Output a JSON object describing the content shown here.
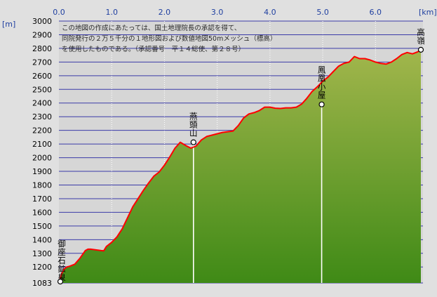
{
  "chart_data": {
    "type": "area",
    "title": "",
    "x_unit": "[km]",
    "y_unit": "[m]",
    "xlim": [
      0,
      6.9
    ],
    "ylim": [
      1083,
      3000
    ],
    "x_ticks": [
      "0.0",
      "1.0",
      "2.0",
      "3.0",
      "4.0",
      "5.0",
      "6.0"
    ],
    "x_tick_values": [
      0,
      1,
      2,
      3,
      4,
      5,
      6
    ],
    "y_ticks": [
      "3000",
      "2900",
      "2800",
      "2700",
      "2600",
      "2500",
      "2400",
      "2300",
      "2200",
      "2100",
      "2000",
      "1900",
      "1800",
      "1700",
      "1600",
      "1500",
      "1400",
      "1300",
      "1200",
      "1083"
    ],
    "y_tick_values": [
      3000,
      2900,
      2800,
      2700,
      2600,
      2500,
      2400,
      2300,
      2200,
      2100,
      2000,
      1900,
      1800,
      1700,
      1600,
      1500,
      1400,
      1300,
      1200,
      1083
    ],
    "grid": true,
    "credit_lines": [
      "この地図の作成にあたっては、国土地理院長の承認を得て、",
      "同院発行の２万５千分の１地形図および数値地図50mメッシュ（標高）",
      "を使用したものである。（承認番号　平１４総使、第２８号）"
    ],
    "series": [
      {
        "x": [
          0,
          0.05,
          0.1,
          0.15,
          0.2,
          0.3,
          0.4,
          0.5,
          0.55,
          0.6,
          0.7,
          0.8,
          0.85,
          0.9,
          0.95,
          1.0,
          1.1,
          1.2,
          1.3,
          1.4,
          1.5,
          1.6,
          1.7,
          1.8,
          1.9,
          2.0,
          2.1,
          2.2,
          2.3,
          2.4,
          2.5,
          2.6,
          2.7,
          2.8,
          2.9,
          3.0,
          3.1,
          3.2,
          3.3,
          3.4,
          3.5,
          3.6,
          3.7,
          3.8,
          3.9,
          4.0,
          4.1,
          4.2,
          4.3,
          4.4,
          4.5,
          4.6,
          4.7,
          4.8,
          4.9,
          5.0,
          5.1,
          5.2,
          5.3,
          5.4,
          5.5,
          5.6,
          5.7,
          5.8,
          5.9,
          6.0,
          6.1,
          6.2,
          6.3,
          6.4,
          6.5,
          6.6,
          6.7,
          6.8,
          6.86
        ],
        "y": [
          1083,
          1150,
          1185,
          1200,
          1205,
          1220,
          1265,
          1320,
          1330,
          1330,
          1325,
          1320,
          1318,
          1350,
          1365,
          1380,
          1420,
          1480,
          1560,
          1640,
          1700,
          1760,
          1815,
          1865,
          1895,
          1945,
          2005,
          2070,
          2113,
          2090,
          2070,
          2085,
          2130,
          2155,
          2165,
          2175,
          2185,
          2190,
          2195,
          2235,
          2290,
          2320,
          2330,
          2345,
          2370,
          2370,
          2362,
          2360,
          2365,
          2365,
          2370,
          2392,
          2435,
          2485,
          2520,
          2560,
          2590,
          2630,
          2670,
          2690,
          2700,
          2740,
          2725,
          2725,
          2715,
          2700,
          2690,
          2685,
          2700,
          2725,
          2755,
          2770,
          2760,
          2775,
          2790
        ]
      }
    ],
    "waypoints": [
      {
        "x": 0,
        "y": 1083,
        "label": "御座石鉱泉"
      },
      {
        "x": 2.55,
        "y": 2113,
        "label": "燕頭山"
      },
      {
        "x": 4.98,
        "y": 2390,
        "label": "鳳凰小屋"
      },
      {
        "x": 6.86,
        "y": 2790,
        "label": "高嶺"
      }
    ],
    "colors": {
      "background": "#e0e0e0",
      "plot_background": "#d6d6d6",
      "grid": "#3a3aa8",
      "vertical_grid": "#ffffff",
      "profile_line": "#ff0000",
      "fill_top": "#a2b64c",
      "fill_bottom": "#3f8a16",
      "axis_label": "#1f3fa0"
    }
  }
}
